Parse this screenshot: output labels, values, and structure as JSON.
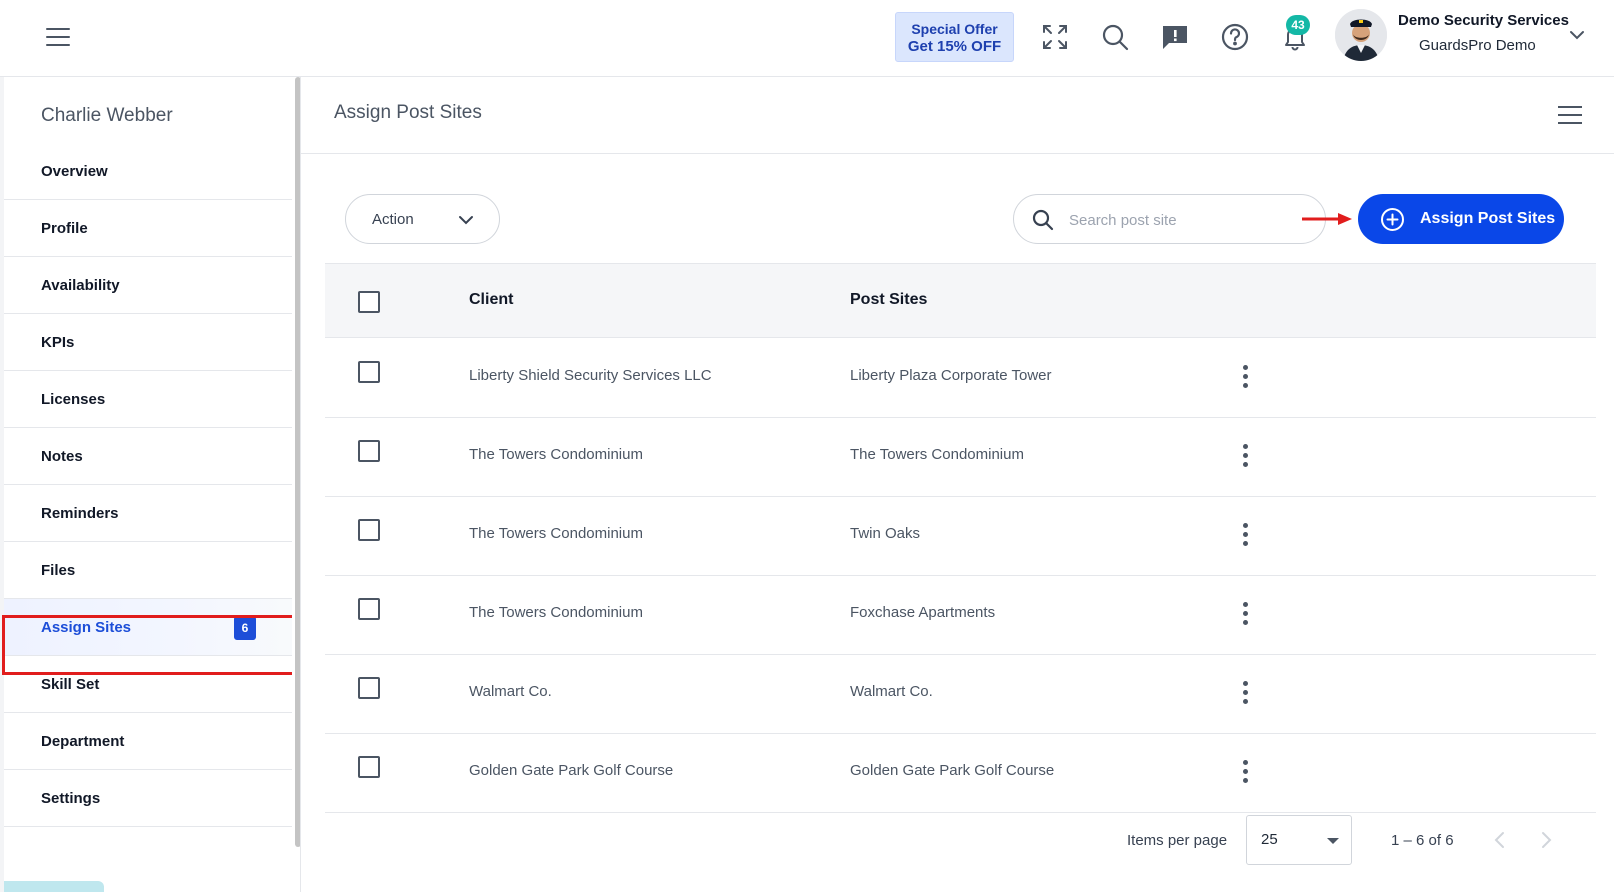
{
  "header": {
    "offer_line1": "Special Offer",
    "offer_line2": "Get 15% OFF",
    "notification_count": "43",
    "company_name": "Demo Security Services",
    "company_sub": "GuardsPro Demo",
    "icons": [
      "menu-icon",
      "expand-icon",
      "search-icon",
      "feedback-icon",
      "help-icon",
      "bell-icon",
      "chevron-down-icon"
    ]
  },
  "sidebar": {
    "title": "Charlie Webber",
    "items": [
      {
        "label": "Overview"
      },
      {
        "label": "Profile"
      },
      {
        "label": "Availability"
      },
      {
        "label": "KPIs"
      },
      {
        "label": "Licenses"
      },
      {
        "label": "Notes"
      },
      {
        "label": "Reminders"
      },
      {
        "label": "Files"
      },
      {
        "label": "Assign Sites",
        "badge": "6",
        "active": true
      },
      {
        "label": "Skill Set"
      },
      {
        "label": "Department"
      },
      {
        "label": "Settings"
      }
    ]
  },
  "main": {
    "title": "Assign Post Sites",
    "action_label": "Action",
    "search_placeholder": "Search post site",
    "assign_button_label": "Assign Post Sites",
    "columns": {
      "client": "Client",
      "post_sites": "Post Sites"
    },
    "rows": [
      {
        "client": "Liberty Shield Security Services LLC",
        "post_site": "Liberty Plaza Corporate Tower"
      },
      {
        "client": "The Towers Condominium",
        "post_site": "The Towers Condominium"
      },
      {
        "client": "The Towers Condominium",
        "post_site": "Twin Oaks"
      },
      {
        "client": "The Towers Condominium",
        "post_site": "Foxchase Apartments"
      },
      {
        "client": "Walmart Co.",
        "post_site": "Walmart Co."
      },
      {
        "client": "Golden Gate Park Golf Course",
        "post_site": "Golden Gate Park Golf Course"
      }
    ],
    "pagination": {
      "items_per_page_label": "Items per page",
      "items_per_page": "25",
      "range": "1 – 6 of 6"
    }
  },
  "colors": {
    "accent": "#0a47e8",
    "highlight": "#e11d1d",
    "notification": "#14b8a6"
  }
}
